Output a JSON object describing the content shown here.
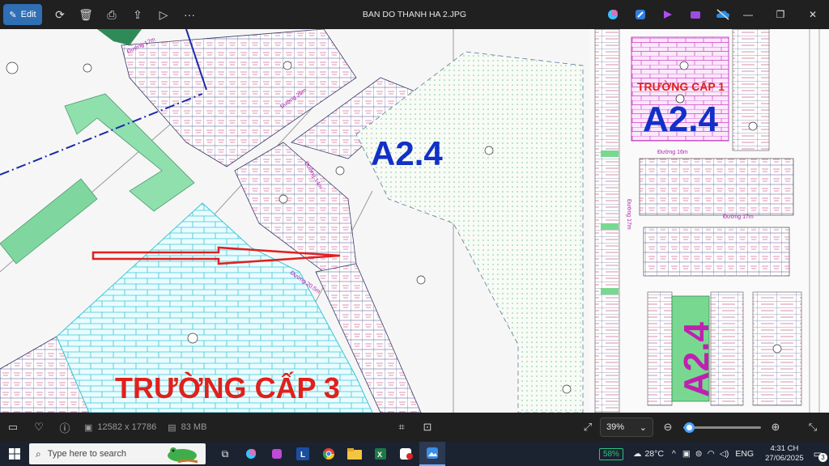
{
  "toolbar": {
    "edit_label": "Edit",
    "title": "BAN DO THANH HA 2.JPG"
  },
  "map": {
    "labels": {
      "a24_center": "A2.4",
      "a24_right": "A2.4",
      "a24_vertical": "A2.4",
      "truong_cap_1": "TRƯỜNG CẤP 1",
      "truong_cap_3": "TRƯỜNG CẤP 3",
      "road_17m_a": "Đường 17m",
      "road_25m": "Đường 25m",
      "road_14m": "Đường 14m",
      "road_17m_b": "Đường 17m",
      "road_17m_c": "Đường 17m",
      "road_205m": "Đường 20.5m",
      "road_16m": "Đường 16m"
    },
    "colors": {
      "blue_label": "#1230c8",
      "red_label": "#e0201c",
      "magenta_label": "#c020b0",
      "school_fill": "#e8fbff",
      "green_area": "#6ed49a"
    }
  },
  "statusbar": {
    "dimensions": "12582 x 17786",
    "file_size": "83 MB",
    "zoom": "39%",
    "zoom_fraction": 0.07
  },
  "taskbar": {
    "search_placeholder": "Type here to search",
    "battery": "58%",
    "temperature": "28°C",
    "language": "ENG",
    "time": "4:31 CH",
    "date": "27/06/2025",
    "notifications": "3"
  }
}
